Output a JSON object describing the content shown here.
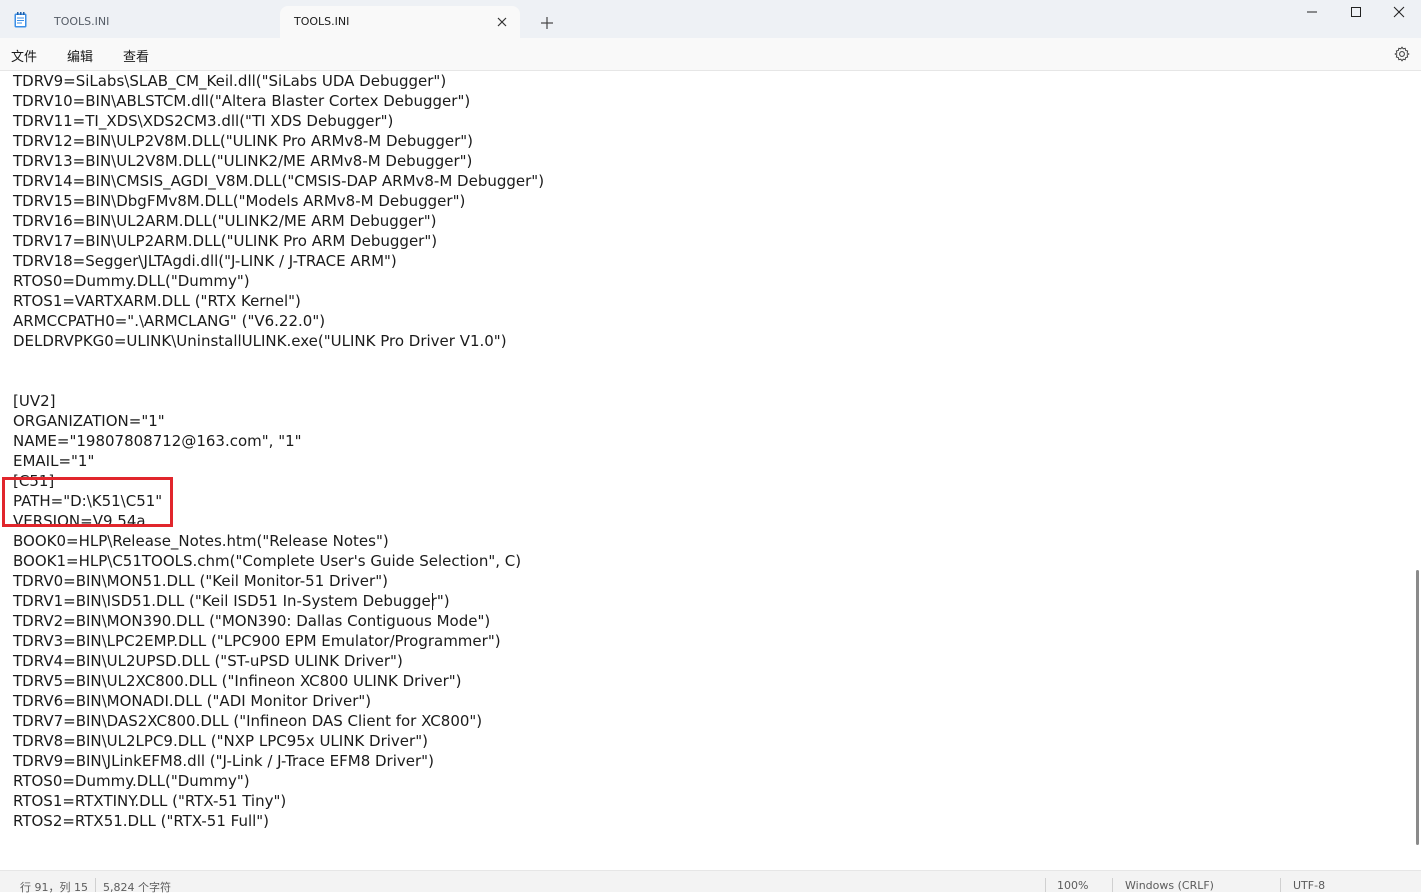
{
  "tabs": [
    {
      "label": "TOOLS.INI",
      "active": false
    },
    {
      "label": "TOOLS.INI",
      "active": true
    }
  ],
  "menu": {
    "file": "文件",
    "edit": "编辑",
    "view": "查看"
  },
  "editor": {
    "lines": [
      "TDRV9=SiLabs\\SLAB_CM_Keil.dll(\"SiLabs UDA Debugger\")",
      "TDRV10=BIN\\ABLSTCM.dll(\"Altera Blaster Cortex Debugger\")",
      "TDRV11=TI_XDS\\XDS2CM3.dll(\"TI XDS Debugger\")",
      "TDRV12=BIN\\ULP2V8M.DLL(\"ULINK Pro ARMv8-M Debugger\")",
      "TDRV13=BIN\\UL2V8M.DLL(\"ULINK2/ME ARMv8-M Debugger\")",
      "TDRV14=BIN\\CMSIS_AGDI_V8M.DLL(\"CMSIS-DAP ARMv8-M Debugger\")",
      "TDRV15=BIN\\DbgFMv8M.DLL(\"Models ARMv8-M Debugger\")",
      "TDRV16=BIN\\UL2ARM.DLL(\"ULINK2/ME ARM Debugger\")",
      "TDRV17=BIN\\ULP2ARM.DLL(\"ULINK Pro ARM Debugger\")",
      "TDRV18=Segger\\JLTAgdi.dll(\"J-LINK / J-TRACE ARM\")",
      "RTOS0=Dummy.DLL(\"Dummy\")",
      "RTOS1=VARTXARM.DLL (\"RTX Kernel\")",
      "ARMCCPATH0=\".\\ARMCLANG\" (\"V6.22.0\")",
      "DELDRVPKG0=ULINK\\UninstallULINK.exe(\"ULINK Pro Driver V1.0\")",
      "",
      "",
      "[UV2]",
      "ORGANIZATION=\"1\"",
      "NAME=\"19807808712@163.com\", \"1\"",
      "EMAIL=\"1\"",
      "[C51]",
      "PATH=\"D:\\K51\\C51\"",
      "VERSION=V9.54a",
      "BOOK0=HLP\\Release_Notes.htm(\"Release Notes\")",
      "BOOK1=HLP\\C51TOOLS.chm(\"Complete User's Guide Selection\", C)",
      "TDRV0=BIN\\MON51.DLL (\"Keil Monitor-51 Driver\")",
      "TDRV1=BIN\\ISD51.DLL (\"Keil ISD51 In-System Debugger\")",
      "TDRV2=BIN\\MON390.DLL (\"MON390: Dallas Contiguous Mode\")",
      "TDRV3=BIN\\LPC2EMP.DLL (\"LPC900 EPM Emulator/Programmer\")",
      "TDRV4=BIN\\UL2UPSD.DLL (\"ST-uPSD ULINK Driver\")",
      "TDRV5=BIN\\UL2XC800.DLL (\"Infineon XC800 ULINK Driver\")",
      "TDRV6=BIN\\MONADI.DLL (\"ADI Monitor Driver\")",
      "TDRV7=BIN\\DAS2XC800.DLL (\"Infineon DAS Client for XC800\")",
      "TDRV8=BIN\\UL2LPC9.DLL (\"NXP LPC95x ULINK Driver\")",
      "TDRV9=BIN\\JLinkEFM8.dll (\"J-Link / J-Trace EFM8 Driver\")",
      "RTOS0=Dummy.DLL(\"Dummy\")",
      "RTOS1=RTXTINY.DLL (\"RTX-51 Tiny\")",
      "RTOS2=RTX51.DLL (\"RTX-51 Full\")"
    ]
  },
  "status": {
    "position": "行 91，列 15",
    "char_count": "5,824 个字符",
    "zoom": "100%",
    "line_ending": "Windows (CRLF)",
    "encoding": "UTF-8"
  },
  "colors": {
    "highlight_box": "#e1262c",
    "titlebar_bg": "#eef1f5",
    "active_tab_bg": "#f9f9f9"
  },
  "icons": [
    "notepad-app-icon",
    "close-icon",
    "plus-icon",
    "minimize-icon",
    "maximize-icon",
    "close-window-icon",
    "gear-icon"
  ]
}
